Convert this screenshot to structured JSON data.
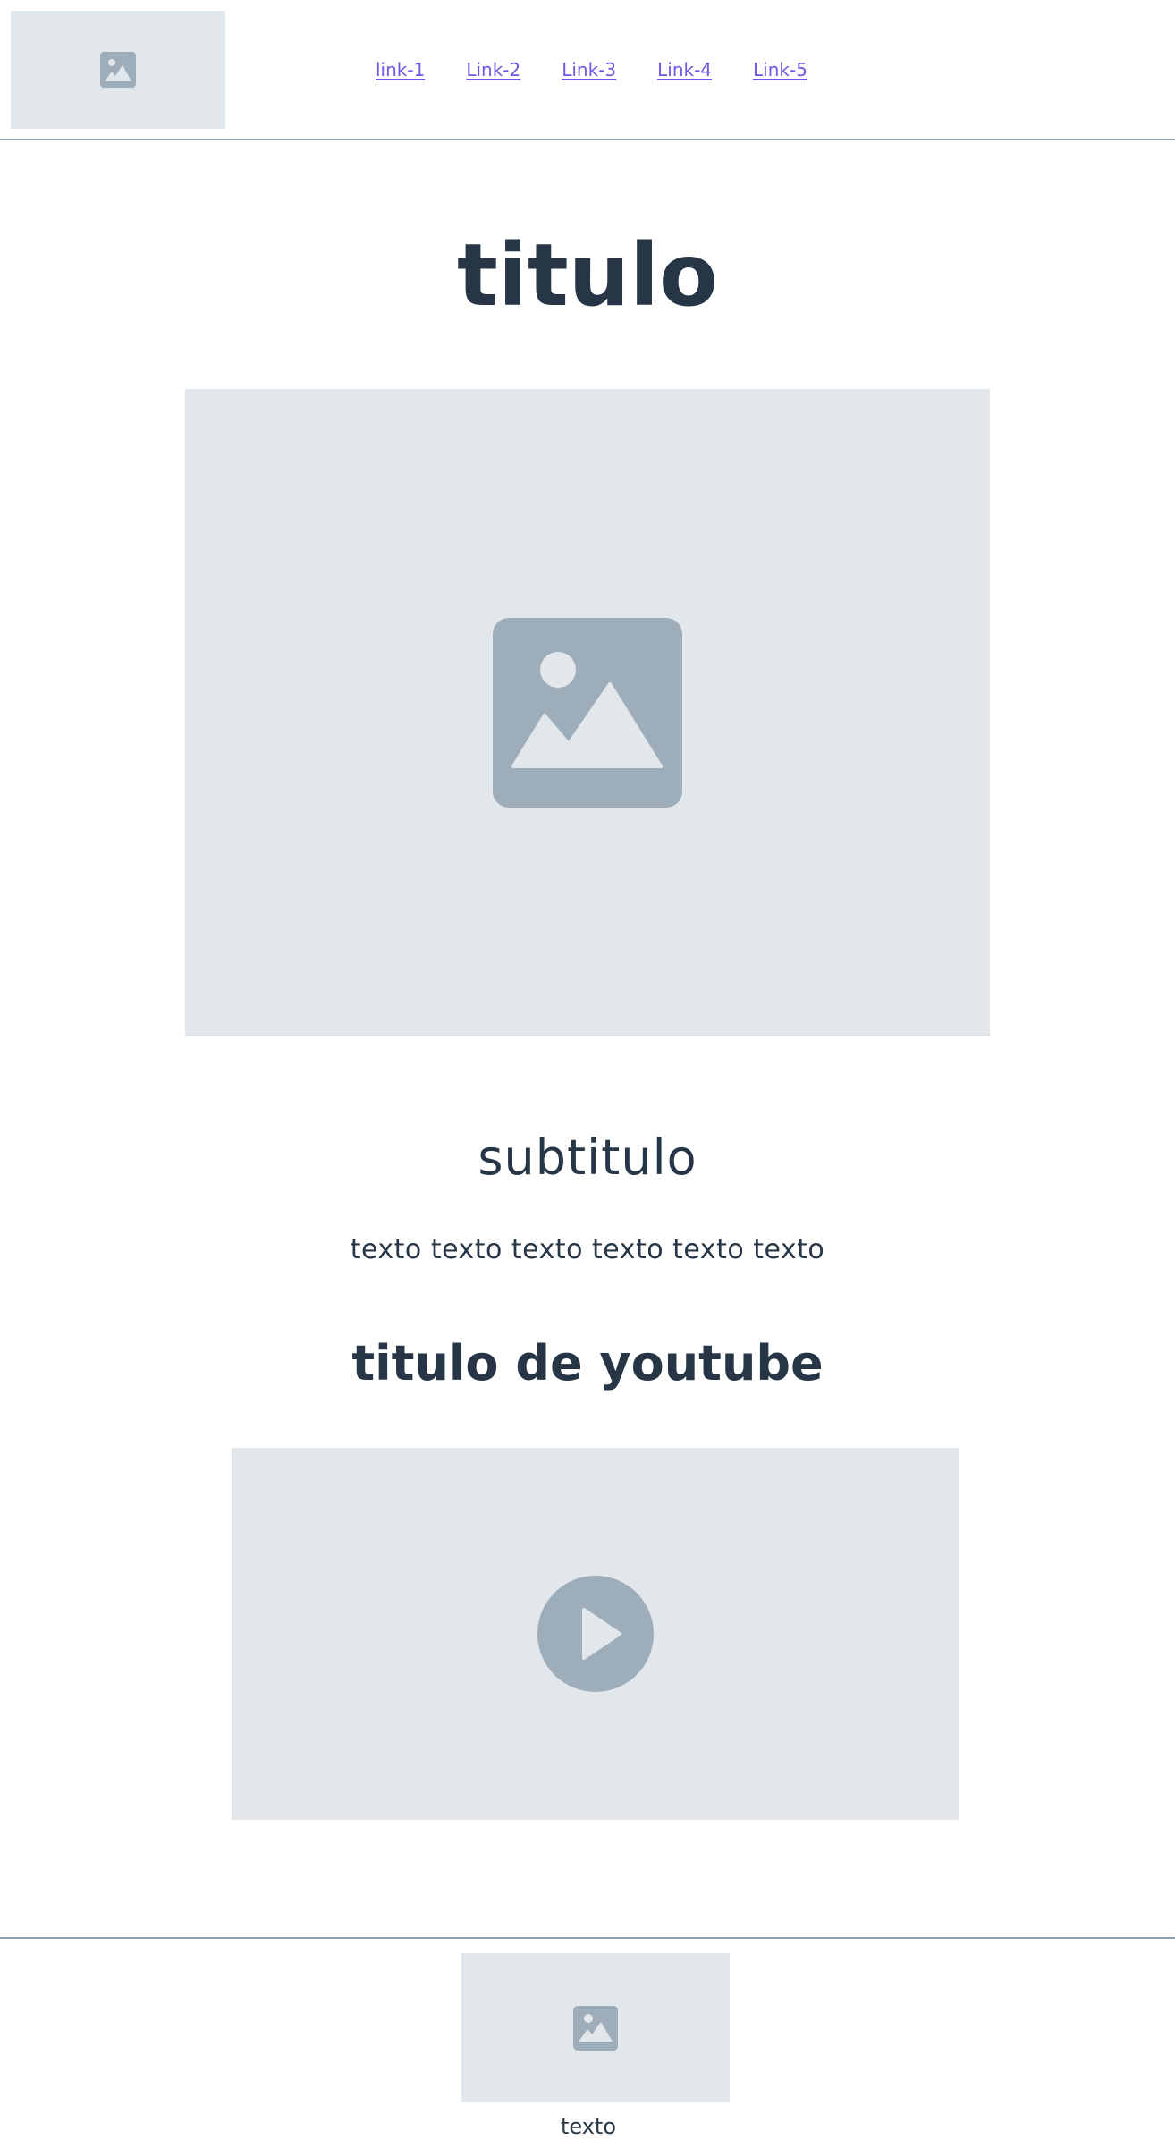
{
  "header": {
    "logo_icon": "image-placeholder-icon",
    "nav_links": [
      "link-1",
      "Link-2",
      "Link-3",
      "Link-4",
      "Link-5"
    ]
  },
  "main": {
    "title": "titulo",
    "hero_icon": "image-placeholder-icon",
    "subtitle": "subtitulo",
    "text": "texto texto texto texto texto texto",
    "youtube_title": "titulo de youtube",
    "video_icon": "play-icon"
  },
  "footer": {
    "image_icon": "image-placeholder-icon",
    "text": "texto"
  },
  "colors": {
    "text": "#263646",
    "link": "#7356e6",
    "placeholder_bg": "#e2e7ec",
    "placeholder_icon": "#9eadba",
    "divider": "#8fa1b3"
  }
}
